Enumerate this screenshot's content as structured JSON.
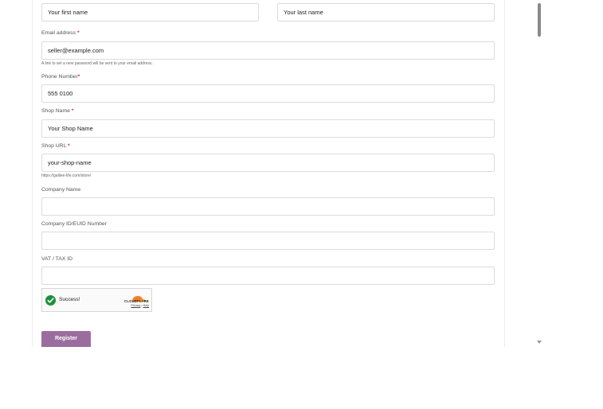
{
  "form": {
    "first_name": {
      "value": "Your first name"
    },
    "last_name": {
      "value": "Your last name"
    },
    "email": {
      "label": "Email address",
      "required": "*",
      "value": "seller@example.com",
      "hint": "A link to set a new password will be sent to your email address."
    },
    "phone": {
      "label": "Phone Number",
      "required": "*",
      "value": "555 0100"
    },
    "shop_name": {
      "label": "Shop Name",
      "required": "*",
      "value": "Your Shop Name"
    },
    "shop_url": {
      "label": "Shop URL",
      "required": "*",
      "value": "your-shop-name",
      "hint": "https://galilee-life.com/store/"
    },
    "company_name": {
      "label": "Company Name",
      "value": ""
    },
    "company_id": {
      "label": "Company ID/EUID Number",
      "value": ""
    },
    "vat": {
      "label": "VAT / TAX ID",
      "value": ""
    },
    "register_label": "Register"
  },
  "captcha": {
    "status": "Success!",
    "brand": "CLOUDFLARE",
    "privacy": "Privacy",
    "separator": "•",
    "help": "Help"
  },
  "colors": {
    "accent": "#9b6d9f",
    "required": "#d9302c",
    "success": "#1f8f3a",
    "cloudflare_orange": "#f38020"
  }
}
